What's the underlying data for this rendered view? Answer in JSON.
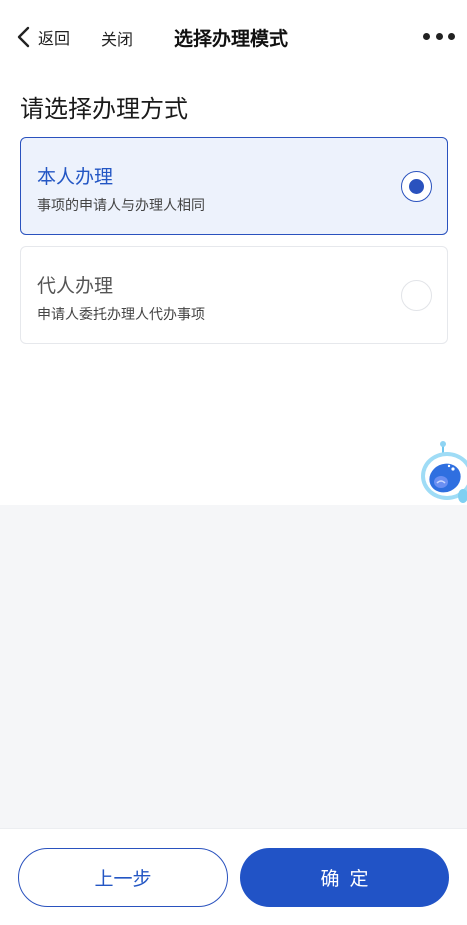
{
  "header": {
    "back_label": "返回",
    "close_label": "关闭",
    "title": "选择办理模式",
    "more_icon": "more-horizontal-icon",
    "back_icon": "chevron-left-icon"
  },
  "main": {
    "section_title": "请选择办理方式",
    "options": [
      {
        "title": "本人办理",
        "description": "事项的申请人与办理人相同",
        "selected": true
      },
      {
        "title": "代人办理",
        "description": "申请人委托办理人代办事项",
        "selected": false
      }
    ]
  },
  "assistant": {
    "icon": "assistant-mascot-icon"
  },
  "footer": {
    "prev_label": "上一步",
    "confirm_label": "确定"
  },
  "colors": {
    "accent": "#2153c6",
    "selected_bg": "#edf2fc",
    "gray_bg": "#f5f6f8"
  }
}
